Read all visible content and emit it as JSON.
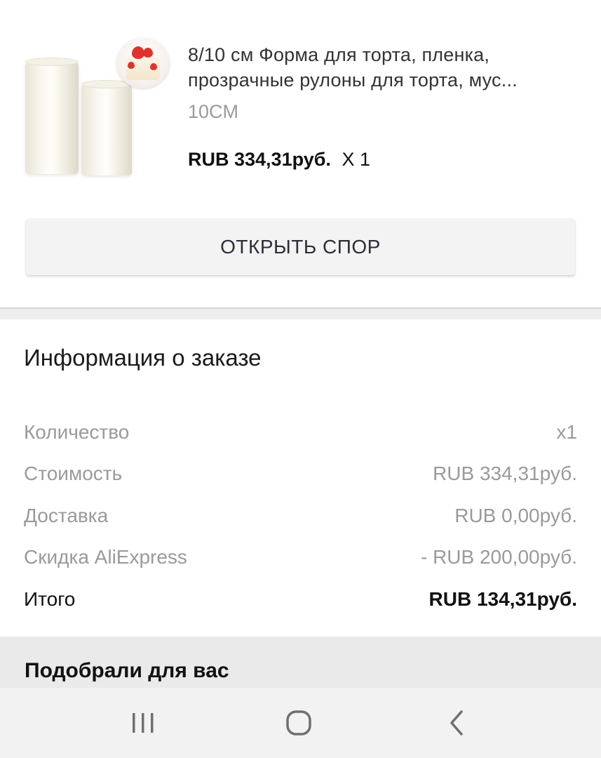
{
  "product": {
    "title_line1": "8/10 см Форма для торта, пленка,",
    "title_line2": "прозрачные рулоны для торта, мус...",
    "variant": "10CM",
    "price": "RUB 334,31руб.",
    "quantity": "X 1",
    "image_icon": "cake-film-roll-image"
  },
  "actions": {
    "open_dispute": "ОТКРЫТЬ СПОР"
  },
  "order_info": {
    "title": "Информация о заказе",
    "rows": [
      {
        "label": "Количество",
        "value": "x1"
      },
      {
        "label": "Стоимость",
        "value": "RUB 334,31руб."
      },
      {
        "label": "Доставка",
        "value": "RUB 0,00руб."
      },
      {
        "label": "Скидка AliExpress",
        "value": "- RUB 200,00руб."
      },
      {
        "label": "Итого",
        "value": "RUB 134,31руб."
      }
    ]
  },
  "recommendations": {
    "title": "Подобрали для вас"
  },
  "navbar": {
    "recents_icon": "recent-apps-icon",
    "home_icon": "home-icon",
    "back_icon": "back-chevron-icon"
  },
  "colors": {
    "primary_text": "#333333",
    "secondary_text": "#9a9a9a",
    "button_bg": "#f3f3f3",
    "section_gap": "#eeeeee",
    "navbar_bg": "#f2f2f2"
  }
}
